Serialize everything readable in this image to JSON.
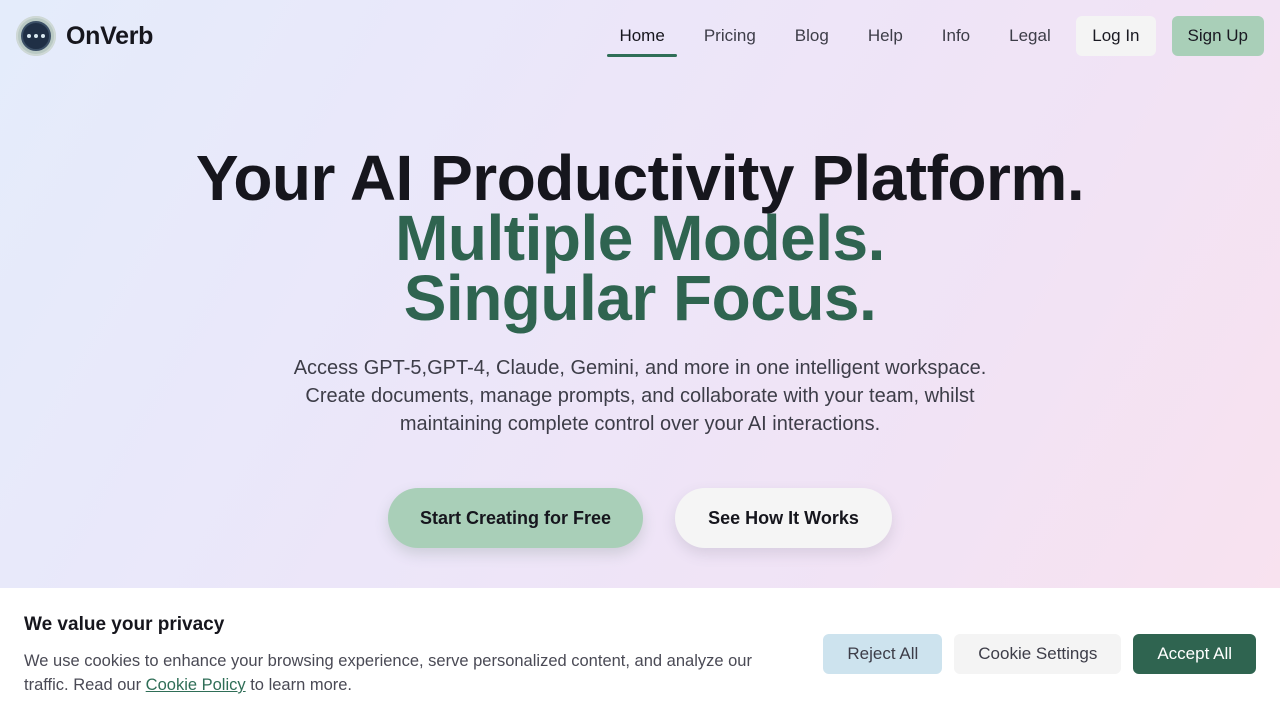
{
  "brand": {
    "name": "OnVerb"
  },
  "nav": {
    "links": [
      "Home",
      "Pricing",
      "Blog",
      "Help",
      "Info",
      "Legal"
    ],
    "active": "Home",
    "login": "Log In",
    "signup": "Sign Up"
  },
  "hero": {
    "line1": "Your AI Productivity Platform.",
    "line2": "Multiple Models.",
    "line3": "Singular Focus.",
    "sub_line1": "Access GPT-5,GPT-4, Claude, Gemini, and more in one intelligent workspace.",
    "sub_line2": "Create documents, manage prompts, and collaborate with your team, whilst",
    "sub_line3": "maintaining complete control over your AI interactions.",
    "primary_cta": "Start Creating for Free",
    "secondary_cta": "See How It Works"
  },
  "cookie": {
    "title": "We value your privacy",
    "text_before": "We use cookies to enhance your browsing experience, serve personalized content, and analyze our traffic. Read our ",
    "link": "Cookie Policy",
    "text_after": " to learn more.",
    "reject": "Reject All",
    "settings": "Cookie Settings",
    "accept": "Accept All"
  },
  "colors": {
    "accent_green": "#2f6450",
    "button_green": "#a9cfb8",
    "reject_blue": "#cde3ee"
  }
}
